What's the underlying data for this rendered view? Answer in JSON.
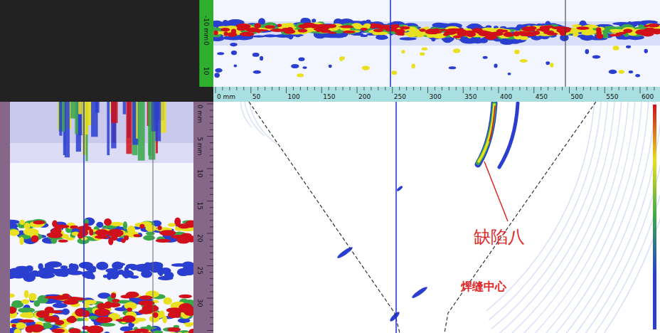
{
  "rulers": {
    "horizontal": {
      "labels": [
        "0 mm",
        "50",
        "100",
        "150",
        "200",
        "250",
        "300",
        "350",
        "400",
        "450",
        "500",
        "550",
        "600"
      ]
    },
    "index_axis": {
      "labels": [
        "-10 mm",
        "0",
        "10"
      ]
    },
    "depth_axis": {
      "labels": [
        "0 mm",
        "5 mm",
        "10",
        "15",
        "20",
        "25",
        "30"
      ]
    }
  },
  "annotations": [
    {
      "label": "缺陷八",
      "kind": "defect"
    },
    {
      "label": "焊缝中心",
      "kind": "weld-center"
    }
  ]
}
